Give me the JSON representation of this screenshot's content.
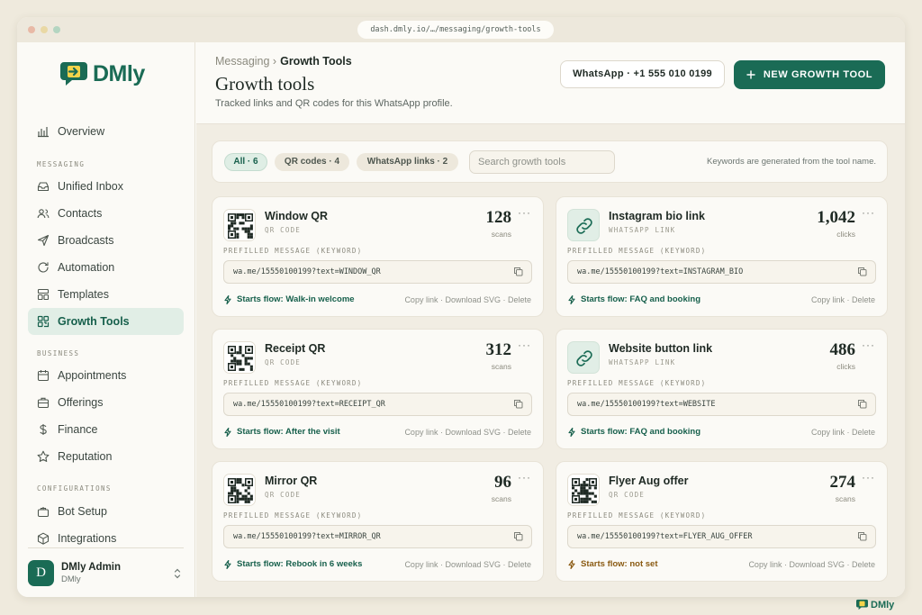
{
  "browser": {
    "url": "dash.dmly.io/…/messaging/growth-tools",
    "dot_colors": [
      "#e8b9a6",
      "#e9d8a4",
      "#b4d5c1"
    ]
  },
  "brand": {
    "name": "DMly",
    "color": "#1a6b55"
  },
  "sidebar": {
    "overview": "Overview",
    "sections": {
      "messaging": "MESSAGING",
      "business": "BUSINESS",
      "configurations": "CONFIGURATIONS"
    },
    "items": {
      "unified_inbox": "Unified Inbox",
      "contacts": "Contacts",
      "broadcasts": "Broadcasts",
      "automation": "Automation",
      "templates": "Templates",
      "growth_tools": "Growth Tools",
      "appointments": "Appointments",
      "offerings": "Offerings",
      "finance": "Finance",
      "reputation": "Reputation",
      "bot_setup": "Bot Setup",
      "integrations": "Integrations"
    },
    "active": "growth_tools",
    "user": {
      "initial": "D",
      "name": "DMly Admin",
      "org": "DMly"
    }
  },
  "header": {
    "breadcrumb_parent": "Messaging ›",
    "breadcrumb_current": "Growth Tools",
    "title": "Growth tools",
    "subtitle": "Tracked links and QR codes for this WhatsApp profile.",
    "whatsapp_label": "WhatsApp · +1 555 010 0199",
    "new_button": "NEW GROWTH TOOL"
  },
  "filters": {
    "chips": [
      "All · 6",
      "QR codes · 4",
      "WhatsApp links · 2"
    ],
    "active": 0,
    "search_placeholder": "Search growth tools",
    "note": "Keywords are generated from the tool name."
  },
  "prefill_label": "PREFILLED MESSAGE (KEYWORD)",
  "tools": [
    {
      "name": "Window QR",
      "type": "QR CODE",
      "kind": "qr",
      "count": "128",
      "unit": "scans",
      "link": "wa.me/15550100199?text=WINDOW_QR",
      "flow": "Starts flow: Walk-in welcome",
      "flow_ok": true,
      "actions": "Copy link · Download SVG · Delete"
    },
    {
      "name": "Instagram bio link",
      "type": "WHATSAPP LINK",
      "kind": "link",
      "count": "1,042",
      "unit": "clicks",
      "link": "wa.me/15550100199?text=INSTAGRAM_BIO",
      "flow": "Starts flow: FAQ and booking",
      "flow_ok": true,
      "actions": "Copy link · Delete"
    },
    {
      "name": "Receipt QR",
      "type": "QR CODE",
      "kind": "qr",
      "count": "312",
      "unit": "scans",
      "link": "wa.me/15550100199?text=RECEIPT_QR",
      "flow": "Starts flow: After the visit",
      "flow_ok": true,
      "actions": "Copy link · Download SVG · Delete"
    },
    {
      "name": "Website button link",
      "type": "WHATSAPP LINK",
      "kind": "link",
      "count": "486",
      "unit": "clicks",
      "link": "wa.me/15550100199?text=WEBSITE",
      "flow": "Starts flow: FAQ and booking",
      "flow_ok": true,
      "actions": "Copy link · Delete"
    },
    {
      "name": "Mirror QR",
      "type": "QR CODE",
      "kind": "qr",
      "count": "96",
      "unit": "scans",
      "link": "wa.me/15550100199?text=MIRROR_QR",
      "flow": "Starts flow: Rebook in 6 weeks",
      "flow_ok": true,
      "actions": "Copy link · Download SVG · Delete"
    },
    {
      "name": "Flyer Aug offer",
      "type": "QR CODE",
      "kind": "qr",
      "count": "274",
      "unit": "scans",
      "link": "wa.me/15550100199?text=FLYER_AUG_OFFER",
      "flow": "Starts flow: not set",
      "flow_ok": false,
      "actions": "Copy link · Download SVG · Delete"
    }
  ]
}
